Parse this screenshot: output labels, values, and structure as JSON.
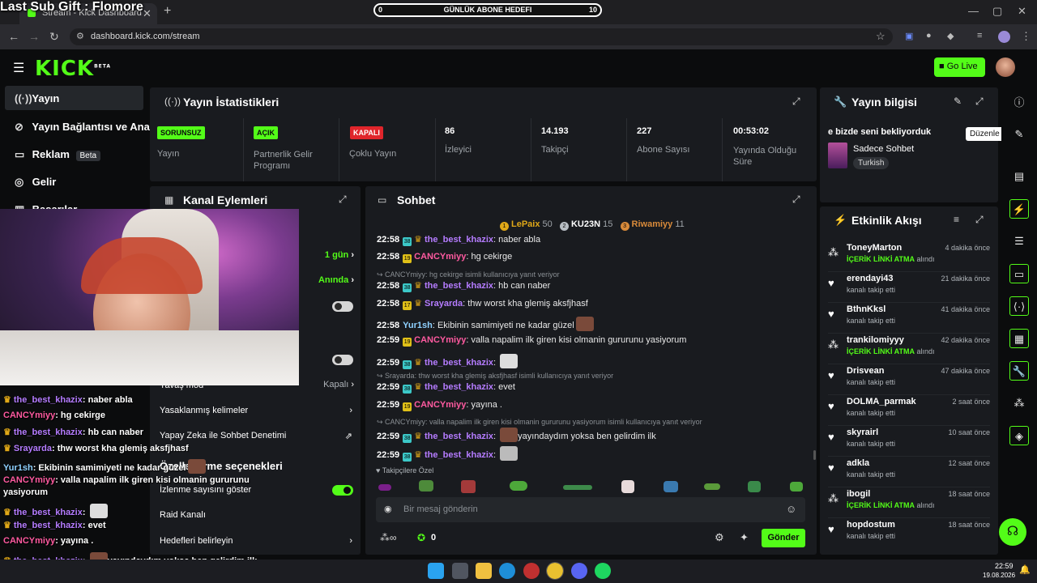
{
  "browser": {
    "tab_title": "Stream - Kick Dashboard",
    "url": "dashboard.kick.com/stream"
  },
  "overlay": {
    "top_title": "Last Sub Gift : Flomore",
    "goal": {
      "start": "0",
      "label": "GÜNLÜK ABONE HEDEFI",
      "end": "10",
      "progress": 0
    }
  },
  "header": {
    "logo": "KICK",
    "logo_sup": "BETA",
    "go_live": "Go Live"
  },
  "sidebar": {
    "items": [
      {
        "label": "Yayın",
        "icon": "broadcast-icon"
      },
      {
        "label": "Yayın Bağlantısı ve Anahtarı",
        "icon": "link-icon"
      },
      {
        "label": "Reklam",
        "icon": "ad-icon",
        "badge": "Beta"
      },
      {
        "label": "Gelir",
        "icon": "wallet-icon"
      },
      {
        "label": "Başarılar",
        "icon": "chart-icon"
      }
    ]
  },
  "stats": {
    "title": "Yayın İstatistikleri",
    "cells": [
      {
        "badge": "SORUNSUZ",
        "badge_color": "#53fc18",
        "label": "Yayın"
      },
      {
        "badge": "AÇIK",
        "badge_color": "#53fc18",
        "label": "Partnerlik Gelir Programı"
      },
      {
        "badge": "KAPALI",
        "badge_color": "#e0252b",
        "label": "Çoklu Yayın"
      },
      {
        "value": "86",
        "label": "İzleyici"
      },
      {
        "value": "14.193",
        "label": "Takipçi"
      },
      {
        "value": "227",
        "label": "Abone Sayısı"
      },
      {
        "value": "00:53:02",
        "label": "Yayında Olduğu Süre"
      }
    ]
  },
  "info": {
    "title": "Yayın bilgisi",
    "stream_title": "e bizde seni bekliyorduk",
    "category": "Sadece Sohbet",
    "language": "Turkish",
    "tooltip": "Düzenle"
  },
  "actions": {
    "title": "Kanal Eylemleri",
    "rows": [
      {
        "value": "1 gün"
      },
      {
        "value": "Anında"
      },
      {
        "label": "Yavaş mod",
        "value": "Kapalı"
      },
      {
        "label": "Yasaklanmış kelimeler"
      },
      {
        "label": "Yapay Zeka ile Sohbet Denetimi"
      },
      {
        "label": "İzlenme sayısını göster"
      },
      {
        "label": "Raid Kanalı"
      },
      {
        "label": "Hedefleri belirleyin"
      }
    ],
    "section_title": "Özelleştirme seçenekleri"
  },
  "chat": {
    "title": "Sohbet",
    "leaders": [
      {
        "rank": "1",
        "name": "LePaix",
        "count": "50",
        "color": "#e0a818"
      },
      {
        "rank": "2",
        "name": "KU23N",
        "count": "15",
        "color": "#b8bec4"
      },
      {
        "rank": "3",
        "name": "Riwamiyy",
        "count": "11",
        "color": "#d88a3a"
      }
    ],
    "messages": [
      {
        "time": "22:58",
        "sub": "38",
        "user": "the_best_khazix",
        "color": "#b57cff",
        "text": "naber abla"
      },
      {
        "time": "22:58",
        "sub": "19",
        "user": "CANCYmiyy",
        "color": "#ff5aa0",
        "text": "hg cekirge"
      },
      {
        "reply": "CANCYmiyy: hg cekirge isimli kullanıcıya yanıt veriyor"
      },
      {
        "time": "22:58",
        "sub": "38",
        "user": "the_best_khazix",
        "color": "#b57cff",
        "text": "hb can naber"
      },
      {
        "time": "22:58",
        "sub": "17",
        "user": "Srayarda",
        "color": "#b57cff",
        "text": "thw worst kha glemiş aksfjhasf"
      },
      {
        "time": "22:58",
        "user": "Yur1sh",
        "color": "#8fd1ff",
        "text": "Ekibinin samimiyeti ne kadar güzel"
      },
      {
        "time": "22:59",
        "sub": "19",
        "user": "CANCYmiyy",
        "color": "#ff5aa0",
        "text": "valla napalim ilk giren kisi olmanin gururunu yasiyorum"
      },
      {
        "time": "22:59",
        "sub": "38",
        "user": "the_best_khazix",
        "color": "#b57cff",
        "text": ""
      },
      {
        "reply": "Srayarda: thw worst kha glemiş aksfjhasf isimli kullanıcıya yanıt veriyor"
      },
      {
        "time": "22:59",
        "sub": "38",
        "user": "the_best_khazix",
        "color": "#b57cff",
        "text": "evet"
      },
      {
        "time": "22:59",
        "sub": "19",
        "user": "CANCYmiyy",
        "color": "#ff5aa0",
        "text": "yayına ."
      },
      {
        "reply": "CANCYmiyy: valla napalim ilk giren kisi olmanin gururunu yasiyorum isimli kullanıcıya yanıt veriyor"
      },
      {
        "time": "22:59",
        "sub": "38",
        "user": "the_best_khazix",
        "color": "#b57cff",
        "text": "yayındaydım yoksa ben gelirdim ilk"
      },
      {
        "time": "22:59",
        "sub": "38",
        "user": "the_best_khazix",
        "color": "#b57cff",
        "text": ""
      }
    ],
    "followers_only": "Takipçilere Özel",
    "input_placeholder": "Bir mesaj gönderin",
    "points": "0",
    "send": "Gönder"
  },
  "activity": {
    "title": "Etkinlik Akışı",
    "items": [
      {
        "name": "ToneyMarton",
        "hl": "İÇERİK LİNKİ ATMA",
        "desc": "alındı",
        "time": "4 dakika önce",
        "icon": "people-icon"
      },
      {
        "name": "erendayi43",
        "desc": "kanalı takip etti",
        "time": "21 dakika önce",
        "icon": "heart-icon"
      },
      {
        "name": "BthnKksl",
        "desc": "kanalı takip etti",
        "time": "41 dakika önce",
        "icon": "heart-icon"
      },
      {
        "name": "trankilomiyyy",
        "hl": "İÇERİK LİNKİ ATMA",
        "desc": "alındı",
        "time": "42 dakika önce",
        "icon": "people-icon"
      },
      {
        "name": "Drisvean",
        "desc": "kanalı takip etti",
        "time": "47 dakika önce",
        "icon": "heart-icon"
      },
      {
        "name": "DOLMA_parmak",
        "desc": "kanalı takip etti",
        "time": "2 saat önce",
        "icon": "heart-icon"
      },
      {
        "name": "skyrairl",
        "desc": "kanalı takip etti",
        "time": "10 saat önce",
        "icon": "heart-icon"
      },
      {
        "name": "adkla",
        "desc": "kanalı takip etti",
        "time": "12 saat önce",
        "icon": "heart-icon"
      },
      {
        "name": "ibogil",
        "hl": "İÇERİK LİNKİ ATMA",
        "desc": "alındı",
        "time": "18 saat önce",
        "icon": "people-icon"
      },
      {
        "name": "hopdostum",
        "desc": "kanalı takip etti",
        "time": "18 saat önce",
        "icon": "heart-icon"
      }
    ]
  },
  "overlay_chat": [
    {
      "user": "the_best_khazix",
      "color": "#b57cff",
      "text": "naber abla"
    },
    {
      "user": "CANCYmiyy",
      "color": "#ff5aa0",
      "text": "hg cekirge"
    },
    {
      "user": "the_best_khazix",
      "color": "#b57cff",
      "text": "hb can naber"
    },
    {
      "user": "Srayarda",
      "color": "#b57cff",
      "text": "thw worst kha glemiş aksfjhasf"
    },
    {
      "user": "Yur1sh",
      "color": "#8fd1ff",
      "text": "Ekibinin samimiyeti ne kadar güzel"
    },
    {
      "user": "CANCYmiyy",
      "color": "#ff5aa0",
      "text": "valla napalim ilk giren kisi olmanin gururunu"
    },
    {
      "user": "",
      "color": "#fff",
      "text": "yasiyorum"
    },
    {
      "user": "the_best_khazix",
      "color": "#b57cff",
      "text": ""
    },
    {
      "user": "the_best_khazix",
      "color": "#b57cff",
      "text": "evet"
    },
    {
      "user": "CANCYmiyy",
      "color": "#ff5aa0",
      "text": "yayına ."
    },
    {
      "user": "the_best_khazix",
      "color": "#b57cff",
      "text": "yayındaydım yoksa ben gelirdim ilk"
    },
    {
      "user": "the_best_khazix",
      "color": "#b57cff",
      "text": ""
    }
  ],
  "taskbar": {
    "time": "22:59",
    "date": "19.08.2026"
  },
  "colors": {
    "accent": "#53fc18",
    "panel": "#191b1f",
    "bg": "#0b0c0d"
  }
}
